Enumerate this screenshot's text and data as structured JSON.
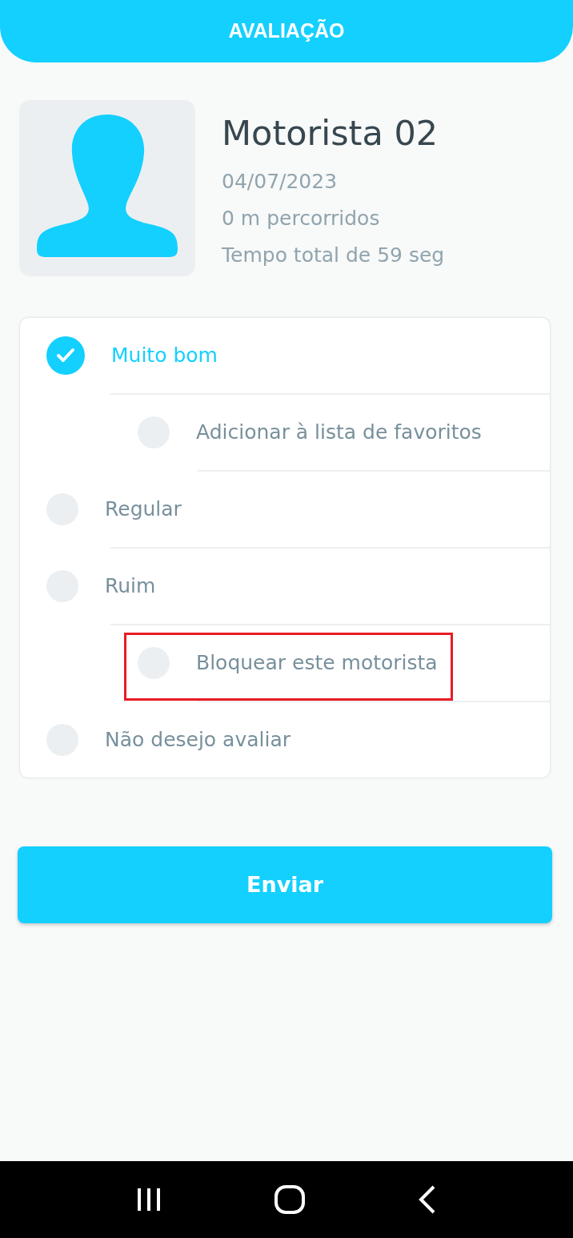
{
  "header": {
    "title": "AVALIAÇÃO"
  },
  "driver": {
    "name": "Motorista 02",
    "date": "04/07/2023",
    "distance": "0 m percorridos",
    "duration": "Tempo total de 59 seg"
  },
  "options": [
    {
      "label": "Muito bom",
      "selected": true,
      "children": [
        {
          "label": "Adicionar à lista de favoritos",
          "selected": false,
          "highlighted": false
        }
      ]
    },
    {
      "label": "Regular",
      "selected": false
    },
    {
      "label": "Ruim",
      "selected": false,
      "children": [
        {
          "label": "Bloquear este motorista",
          "selected": false,
          "highlighted": true
        }
      ]
    },
    {
      "label": "Não desejo avaliar",
      "selected": false
    }
  ],
  "submit_button": "Enviar"
}
